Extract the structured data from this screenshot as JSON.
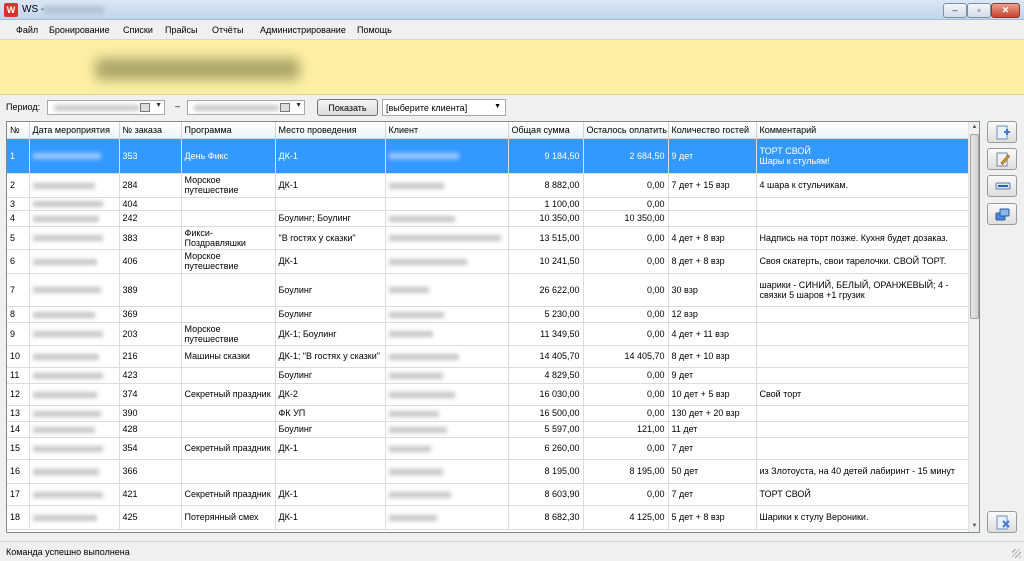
{
  "window": {
    "title": "WS -",
    "app_icon": "W",
    "minimize": "‒",
    "maximize": "▫",
    "close": "✕"
  },
  "menu": [
    "Файл",
    "Бронирование",
    "Списки",
    "Прайсы",
    "Отчёты",
    "Администрирование",
    "Помощь"
  ],
  "filter": {
    "period_label": "Период:",
    "dash": "–",
    "show_button": "Показать",
    "client_select_value": "[выберите клиента]"
  },
  "table": {
    "columns": [
      "№",
      "Дата мероприятия",
      "№ заказа",
      "Программа",
      "Место проведения",
      "Клиент",
      "Общая сумма",
      "Осталось оплатить",
      "Количество гостей",
      "Комментарий"
    ],
    "rows": [
      {
        "n": "1",
        "order": "353",
        "program": "День Фикс",
        "place": "ДК-1",
        "total": "9 184,50",
        "remaining": "2 684,50",
        "guests": "9 дет",
        "comment": "ТОРТ СВОЙ\nШары к стульям!"
      },
      {
        "n": "2",
        "order": "284",
        "program": "Морское путешествие",
        "place": "ДК-1",
        "total": "8 882,00",
        "remaining": "0,00",
        "guests": "7 дет + 15 взр",
        "comment": "4 шара к стульчикам."
      },
      {
        "n": "3",
        "order": "404",
        "program": "",
        "place": "",
        "total": "1 100,00",
        "remaining": "0,00",
        "guests": "",
        "comment": ""
      },
      {
        "n": "4",
        "order": "242",
        "program": "",
        "place": "Боулинг; Боулинг",
        "total": "10 350,00",
        "remaining": "10 350,00",
        "guests": "",
        "comment": ""
      },
      {
        "n": "5",
        "order": "383",
        "program": "Фикси-Поздравляшки",
        "place": "\"В гостях у сказки\"",
        "total": "13 515,00",
        "remaining": "0,00",
        "guests": "4 дет + 8 взр",
        "comment": "Надпись на торт позже. Кухня будет дозаказ."
      },
      {
        "n": "6",
        "order": "406",
        "program": "Морское путешествие",
        "place": "ДК-1",
        "total": "10 241,50",
        "remaining": "0,00",
        "guests": "8 дет + 8 взр",
        "comment": "Своя скатерть, свои тарелочки. СВОЙ ТОРТ."
      },
      {
        "n": "7",
        "order": "389",
        "program": "",
        "place": "Боулинг",
        "total": "26 622,00",
        "remaining": "0,00",
        "guests": "30 взр",
        "comment": "шарики - СИНИЙ, БЕЛЫЙ, ОРАНЖЕВЫЙ; 4 - связки 5 шаров +1 грузик"
      },
      {
        "n": "8",
        "order": "369",
        "program": "",
        "place": "Боулинг",
        "total": "5 230,00",
        "remaining": "0,00",
        "guests": "12 взр",
        "comment": ""
      },
      {
        "n": "9",
        "order": "203",
        "program": "Морское путешествие",
        "place": "ДК-1; Боулинг",
        "total": "11 349,50",
        "remaining": "0,00",
        "guests": "4 дет + 11 взр",
        "comment": ""
      },
      {
        "n": "10",
        "order": "216",
        "program": "Машины сказки",
        "place": "ДК-1; \"В гостях у сказки\"",
        "total": "14 405,70",
        "remaining": "14 405,70",
        "guests": "8 дет + 10 взр",
        "comment": ""
      },
      {
        "n": "11",
        "order": "423",
        "program": "",
        "place": "Боулинг",
        "total": "4 829,50",
        "remaining": "0,00",
        "guests": "9 дет",
        "comment": ""
      },
      {
        "n": "12",
        "order": "374",
        "program": "Секретный праздник",
        "place": "ДК-2",
        "total": "16 030,00",
        "remaining": "0,00",
        "guests": "10 дет + 5 взр",
        "comment": "Свой торт"
      },
      {
        "n": "13",
        "order": "390",
        "program": "",
        "place": "ФК УП",
        "total": "16 500,00",
        "remaining": "0,00",
        "guests": "130 дет + 20 взр",
        "comment": ""
      },
      {
        "n": "14",
        "order": "428",
        "program": "",
        "place": "Боулинг",
        "total": "5 597,00",
        "remaining": "121,00",
        "guests": "11 дет",
        "comment": ""
      },
      {
        "n": "15",
        "order": "354",
        "program": "Секретный праздник",
        "place": "ДК-1",
        "total": "6 260,00",
        "remaining": "0,00",
        "guests": "7 дет",
        "comment": ""
      },
      {
        "n": "16",
        "order": "366",
        "program": "",
        "place": "",
        "total": "8 195,00",
        "remaining": "8 195,00",
        "guests": "50 дет",
        "comment": "из Злотоуста, на 40 детей лабиринт - 15 минут"
      },
      {
        "n": "17",
        "order": "421",
        "program": "Секретный праздник",
        "place": "ДК-1",
        "total": "8 603,90",
        "remaining": "0,00",
        "guests": "7 дет",
        "comment": "ТОРТ СВОЙ"
      },
      {
        "n": "18",
        "order": "425",
        "program": "Потерянный смех",
        "place": "ДК-1",
        "total": "8 682,30",
        "remaining": "4 125,00",
        "guests": "5 дет + 8 взр",
        "comment": "Шарики к стулу Вероники."
      }
    ],
    "selected_row": 1
  },
  "icons": {
    "add": "add-document-icon",
    "edit": "edit-document-icon",
    "delete": "remove-icon",
    "copy": "copy-icon",
    "clear": "clear-icon"
  },
  "status": {
    "text": "Команда успешно выполнена"
  }
}
